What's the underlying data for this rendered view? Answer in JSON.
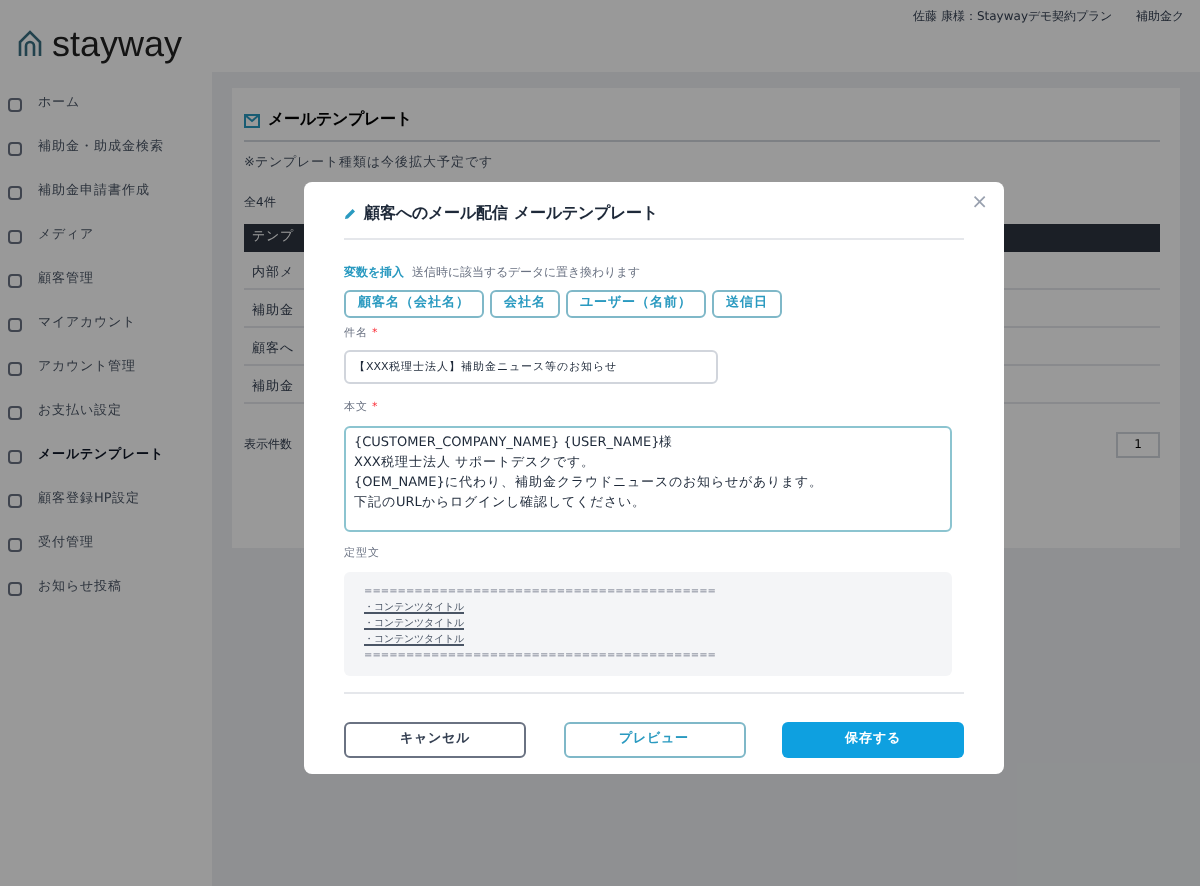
{
  "header": {
    "logo": "stayway",
    "user": "佐藤 康様：Staywayデモ契約プラン",
    "link": "補助金ク"
  },
  "sidebar": {
    "items": [
      {
        "label": "ホーム",
        "selected": false
      },
      {
        "label": "補助金・助成金検索",
        "selected": false
      },
      {
        "label": "補助金申請書作成",
        "selected": false
      },
      {
        "label": "メディア",
        "selected": false
      },
      {
        "label": "顧客管理",
        "selected": false
      },
      {
        "label": "マイアカウント",
        "selected": false
      },
      {
        "label": "アカウント管理",
        "selected": false
      },
      {
        "label": "お支払い設定",
        "selected": false
      },
      {
        "label": "メールテンプレート",
        "selected": true
      },
      {
        "label": "顧客登録HP設定",
        "selected": false
      },
      {
        "label": "受付管理",
        "selected": false
      },
      {
        "label": "お知らせ投稿",
        "selected": false
      }
    ]
  },
  "page": {
    "title": "メールテンプレート",
    "note": "※テンプレート種類は今後拡大予定です",
    "count": "全4件",
    "table_header": "テンプ",
    "rows": [
      "内部メ",
      "補助金",
      "顧客へ",
      "補助金"
    ],
    "page_size_label": "表示件数",
    "page_number": "1"
  },
  "modal": {
    "title": "顧客へのメール配信 メールテンプレート",
    "close": "×",
    "variables_label": "変数を挿入",
    "variables_hint": "送信時に該当するデータに置き換わります",
    "variables": [
      "顧客名（会社名）",
      "会社名",
      "ユーザー（名前）",
      "送信日"
    ],
    "subject_label": "件名",
    "required_mark": "*",
    "subject_value": "【XXX税理士法人】補助金ニュース等のお知らせ",
    "body_label": "本文",
    "body_lines": [
      "{CUSTOMER_COMPANY_NAME} {USER_NAME}様",
      "XXX税理士法人 サポートデスクです。",
      "{OEM_NAME}に代わり、補助金クラウドニュースのお知らせがあります。",
      "下記のURLからログインし確認してください。"
    ],
    "fixed_label": "定型文",
    "fixed_lines": [
      {
        "kind": "rule",
        "text": "=========================================="
      },
      {
        "kind": "link",
        "text": "・コンテンツタイトル"
      },
      {
        "kind": "link",
        "text": "・コンテンツタイトル"
      },
      {
        "kind": "link",
        "text": "・コンテンツタイトル"
      },
      {
        "kind": "rule",
        "text": "=========================================="
      }
    ],
    "buttons": [
      {
        "label": "キャンセル",
        "kind": "secondary"
      },
      {
        "label": "プレビュー",
        "kind": "outline"
      },
      {
        "label": "保存する",
        "kind": "primary"
      }
    ]
  }
}
